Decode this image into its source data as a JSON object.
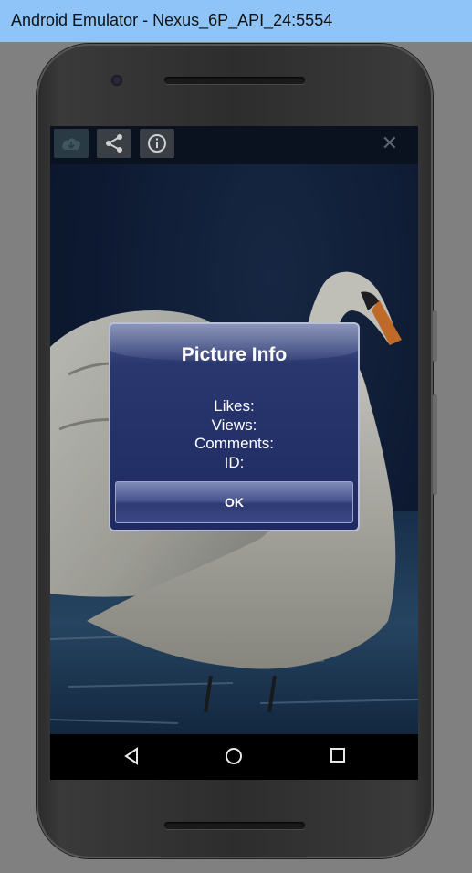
{
  "window": {
    "title": "Android Emulator - Nexus_6P_API_24:5554"
  },
  "toolbar": {
    "download_icon": "cloud-download-icon",
    "share_icon": "share-icon",
    "info_icon": "info-icon",
    "close_glyph": "✕"
  },
  "dialog": {
    "title": "Picture Info",
    "likes_label": "Likes:",
    "views_label": "Views:",
    "comments_label": "Comments:",
    "id_label": "ID:",
    "ok_label": "OK"
  },
  "navbar": {
    "back_icon": "back-triangle-icon",
    "home_icon": "home-circle-icon",
    "recents_icon": "recents-square-icon"
  }
}
